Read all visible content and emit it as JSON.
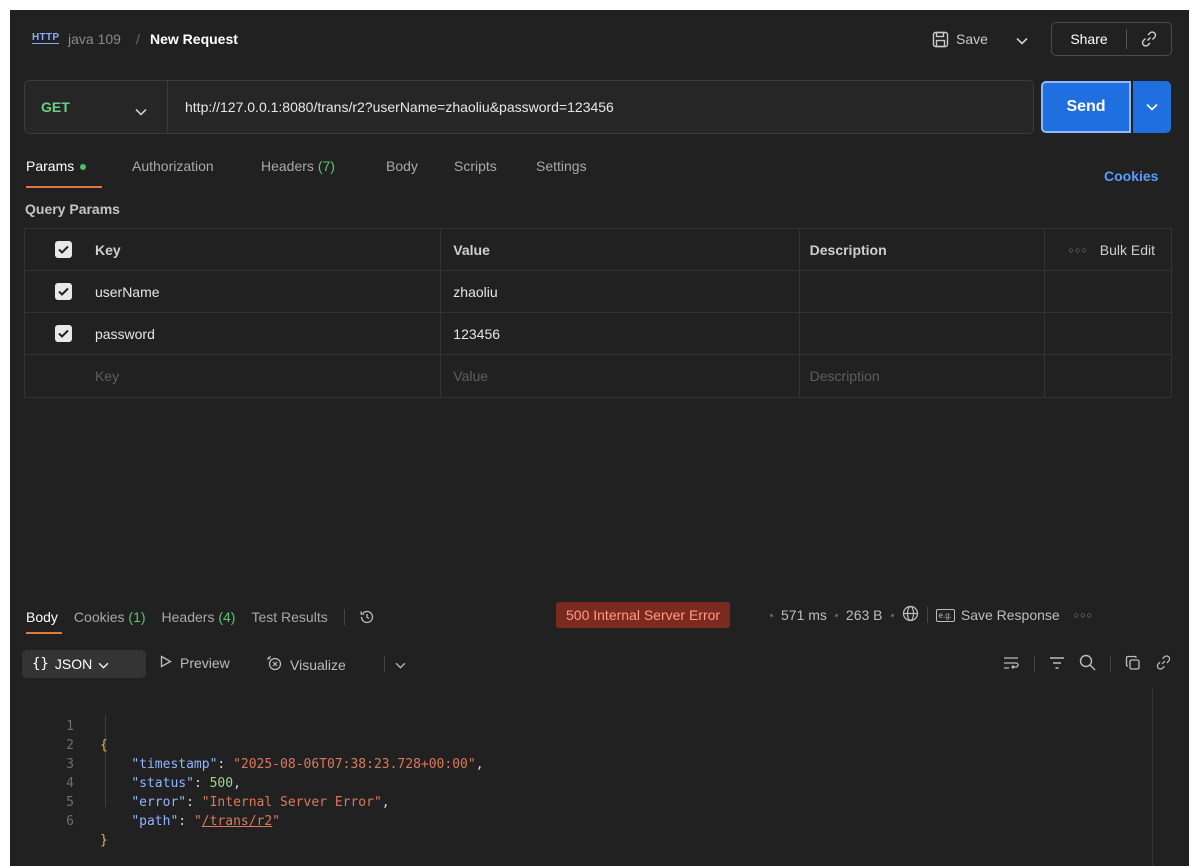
{
  "header": {
    "http_badge": "HTTP",
    "collection": "java 109",
    "separator": "/",
    "request_name": "New Request",
    "save_label": "Save",
    "share_label": "Share"
  },
  "request": {
    "method": "GET",
    "url": "http://127.0.0.1:8080/trans/r2?userName=zhaoliu&password=123456",
    "send_label": "Send"
  },
  "request_tabs": [
    {
      "label": "Params",
      "count": ""
    },
    {
      "label": "Authorization",
      "count": ""
    },
    {
      "label": "Headers",
      "count": "(7)"
    },
    {
      "label": "Body",
      "count": ""
    },
    {
      "label": "Scripts",
      "count": ""
    },
    {
      "label": "Settings",
      "count": ""
    }
  ],
  "cookies_label": "Cookies",
  "query_params": {
    "title": "Query Params",
    "headers": {
      "key": "Key",
      "value": "Value",
      "description": "Description",
      "bulk_edit": "Bulk Edit"
    },
    "rows": [
      {
        "key": "userName",
        "value": "zhaoliu",
        "description": "",
        "checked": true
      },
      {
        "key": "password",
        "value": "123456",
        "description": "",
        "checked": true
      }
    ],
    "placeholder": {
      "key": "Key",
      "value": "Value",
      "description": "Description"
    }
  },
  "response_tabs": [
    {
      "label": "Body",
      "count": ""
    },
    {
      "label": "Cookies",
      "count": "(1)"
    },
    {
      "label": "Headers",
      "count": "(4)"
    },
    {
      "label": "Test Results",
      "count": ""
    }
  ],
  "response_meta": {
    "status": "500 Internal Server Error",
    "time": "571 ms",
    "size": "263 B",
    "save_response": "Save Response",
    "status_color": "#7a2a1f"
  },
  "format_toolbar": {
    "format": "JSON",
    "preview": "Preview",
    "visualize": "Visualize"
  },
  "response_body": {
    "lines": [
      "1",
      "2",
      "3",
      "4",
      "5",
      "6"
    ],
    "open_brace": "{",
    "close_brace": "}",
    "timestamp_key": "\"timestamp\"",
    "timestamp_value": "\"2025-08-06T07:38:23.728+00:00\"",
    "status_key": "\"status\"",
    "status_value": "500",
    "error_key": "\"error\"",
    "error_value": "\"Internal Server Error\"",
    "path_key": "\"path\"",
    "path_value": "/trans/r2"
  },
  "colors": {
    "accent": "#1f6fe0",
    "method": "#6ccf7f",
    "tab_underline": "#e07a3a",
    "background": "#212121"
  }
}
